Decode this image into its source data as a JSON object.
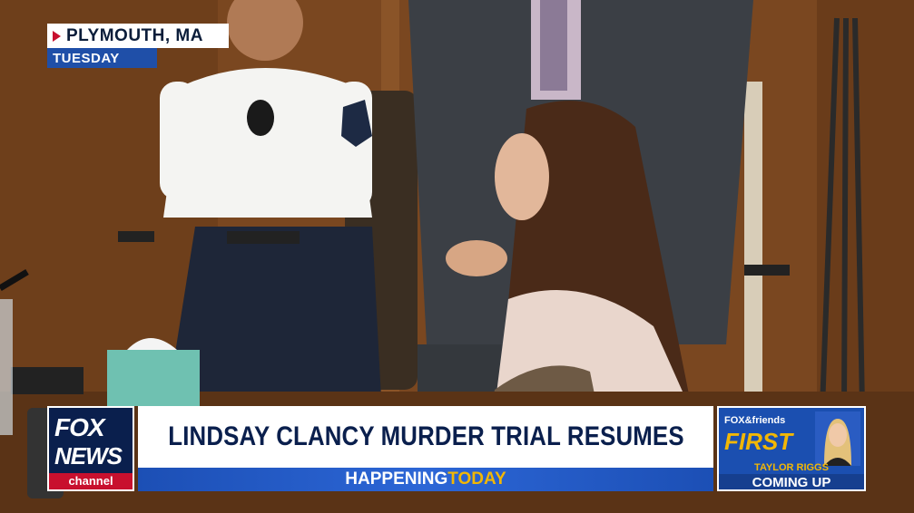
{
  "location": {
    "city": "PLYMOUTH, MA",
    "day": "TUESDAY"
  },
  "logo": {
    "line1": "FOX",
    "line2": "NEWS",
    "line3": "channel"
  },
  "lower_third": {
    "headline": "LINDSAY CLANCY MURDER TRIAL RESUMES",
    "subheadline_part1": "HAPPENING ",
    "subheadline_part2": "TODAY"
  },
  "promo": {
    "show_line": "FOX&friends",
    "show_first": "FIRST",
    "host": "TAYLOR RIGGS",
    "status": "COMING UP"
  },
  "colors": {
    "fox_navy": "#0a1f4d",
    "fox_blue": "#1f4fa8",
    "fox_red": "#c8102e",
    "accent_yellow": "#f2b705"
  }
}
